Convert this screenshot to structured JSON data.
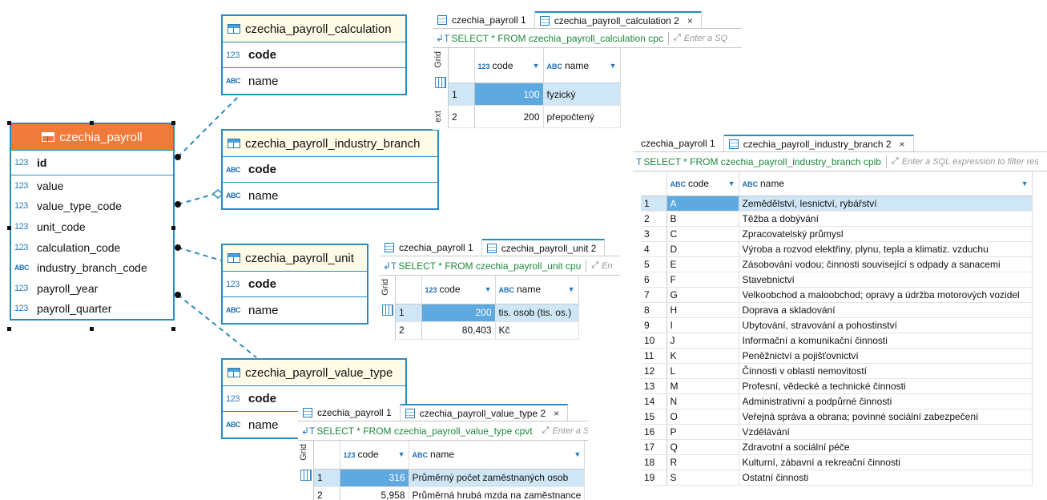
{
  "er": {
    "payroll": {
      "title": "czechia_payroll",
      "columns": [
        {
          "type": "123",
          "name": "id",
          "pk": true
        },
        {
          "type": "123",
          "name": "value",
          "pk": false
        },
        {
          "type": "123",
          "name": "value_type_code",
          "pk": false
        },
        {
          "type": "123",
          "name": "unit_code",
          "pk": false
        },
        {
          "type": "123",
          "name": "calculation_code",
          "pk": false
        },
        {
          "type": "ABC",
          "name": "industry_branch_code",
          "pk": false
        },
        {
          "type": "123",
          "name": "payroll_year",
          "pk": false
        },
        {
          "type": "123",
          "name": "payroll_quarter",
          "pk": false
        }
      ]
    },
    "calculation": {
      "title": "czechia_payroll_calculation",
      "pk_type": "123",
      "pk": "code",
      "col_type": "ABC",
      "col": "name"
    },
    "industry_branch": {
      "title": "czechia_payroll_industry_branch",
      "pk_type": "ABC",
      "pk": "code",
      "col_type": "ABC",
      "col": "name"
    },
    "unit": {
      "title": "czechia_payroll_unit",
      "pk_type": "123",
      "pk": "code",
      "col_type": "ABC",
      "col": "name"
    },
    "value_type": {
      "title": "czechia_payroll_value_type",
      "pk_type": "123",
      "pk": "code",
      "col_type": "ABC",
      "col": "name"
    }
  },
  "panels": {
    "calc": {
      "tab1": "czechia_payroll 1",
      "tab2": "czechia_payroll_calculation 2",
      "close": "×",
      "query": "SELECT * FROM czechia_payroll_calculation cpc",
      "hint": "Enter a SQ",
      "side_label": "Grid",
      "side_label2": "ext",
      "headers": [
        "code",
        "name"
      ],
      "rows": [
        [
          "1",
          "100",
          "fyzický"
        ],
        [
          "2",
          "200",
          "přepočtený"
        ]
      ]
    },
    "branch": {
      "tab1": "czechia_payroll 1",
      "tab2": "czechia_payroll_industry_branch 2",
      "close": "×",
      "query": "SELECT * FROM czechia_payroll_industry_branch cpib",
      "hint": "Enter a SQL expression to filter res",
      "headers": [
        "code",
        "name"
      ],
      "rows": [
        [
          "1",
          "A",
          "Zemědělství, lesnictví, rybářství"
        ],
        [
          "2",
          "B",
          "Těžba a dobývání"
        ],
        [
          "3",
          "C",
          "Zpracovatelský průmysl"
        ],
        [
          "4",
          "D",
          "Výroba a rozvod elektřiny, plynu, tepla a klimatiz. vzduchu"
        ],
        [
          "5",
          "E",
          "Zásobování vodou; činnosti související s odpady a sanacemi"
        ],
        [
          "6",
          "F",
          "Stavebnictví"
        ],
        [
          "7",
          "G",
          "Velkoobchod a maloobchod; opravy a údržba motorových vozidel"
        ],
        [
          "8",
          "H",
          "Doprava a skladování"
        ],
        [
          "9",
          "I",
          "Ubytování, stravování a pohostinství"
        ],
        [
          "10",
          "J",
          "Informační a komunikační činnosti"
        ],
        [
          "11",
          "K",
          "Peněžnictví a pojišťovnictví"
        ],
        [
          "12",
          "L",
          "Činnosti v oblasti nemovitostí"
        ],
        [
          "13",
          "M",
          "Profesní, vědecké a technické činnosti"
        ],
        [
          "14",
          "N",
          "Administrativní a podpůrné činnosti"
        ],
        [
          "15",
          "O",
          "Veřejná správa a obrana; povinné sociální zabezpečení"
        ],
        [
          "16",
          "P",
          "Vzdělávání"
        ],
        [
          "17",
          "Q",
          "Zdravotní a sociální péče"
        ],
        [
          "18",
          "R",
          "Kulturní, zábavní a rekreační činnosti"
        ],
        [
          "19",
          "S",
          "Ostatní činnosti"
        ]
      ]
    },
    "unit": {
      "tab1": "czechia_payroll 1",
      "tab2": "czechia_payroll_unit 2",
      "query": "SELECT * FROM czechia_payroll_unit cpu",
      "hint": "En",
      "side_label": "Grid",
      "headers": [
        "code",
        "name"
      ],
      "rows": [
        [
          "1",
          "200",
          "tis. osob (tis. os.)"
        ],
        [
          "2",
          "80,403",
          "Kč"
        ]
      ]
    },
    "vtype": {
      "tab1": "czechia_payroll 1",
      "tab2": "czechia_payroll_value_type 2",
      "close": "×",
      "query": "SELECT * FROM czechia_payroll_value_type cpvt",
      "hint": "Enter a SQL",
      "side_label": "Grid",
      "headers": [
        "code",
        "name"
      ],
      "rows": [
        [
          "1",
          "316",
          "Průměrný počet zaměstnaných osob"
        ],
        [
          "2",
          "5,958",
          "Průměrná hrubá mzda na zaměstnance"
        ]
      ]
    }
  },
  "colors": {
    "accent": "#2a8bbf",
    "header_orange": "#f07a3a",
    "selection": "#5da9e0",
    "query_green": "#1b8a3a"
  }
}
